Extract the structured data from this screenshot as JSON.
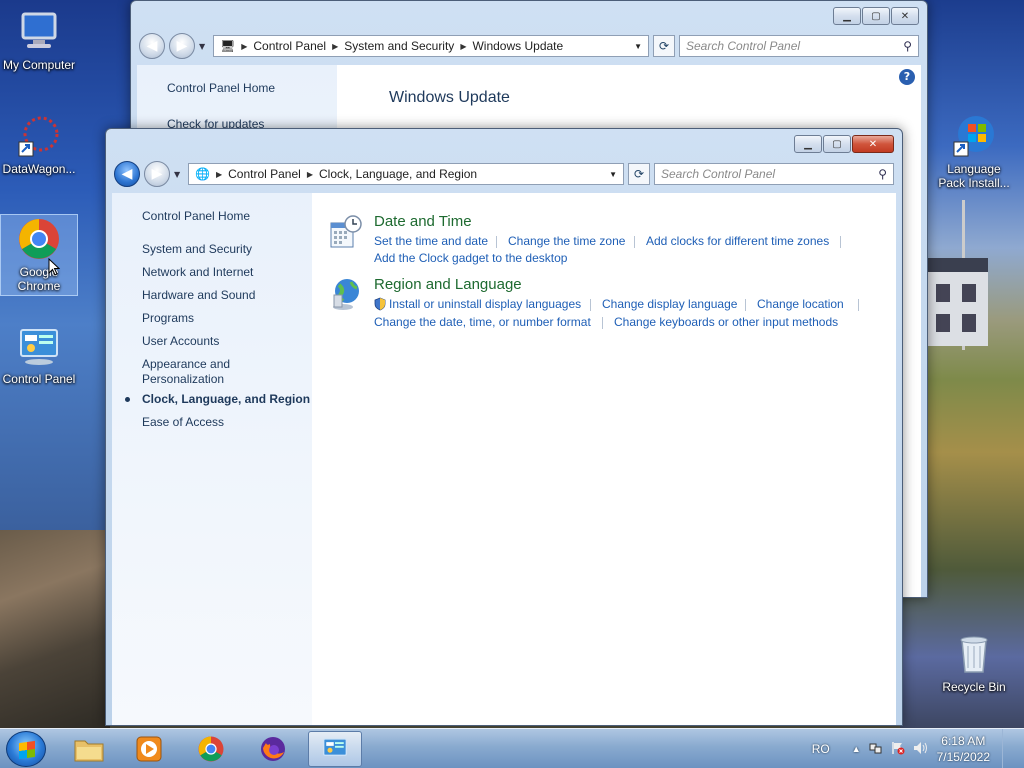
{
  "desktop": {
    "icons": [
      {
        "label": "My Computer"
      },
      {
        "label": "DataWagon..."
      },
      {
        "label": "Google Chrome"
      },
      {
        "label": "Control Panel"
      },
      {
        "label": "Language Pack Install..."
      },
      {
        "label": "Recycle Bin"
      }
    ]
  },
  "back_window": {
    "breadcrumb": [
      "Control Panel",
      "System and Security",
      "Windows Update"
    ],
    "search_placeholder": "Search Control Panel",
    "sidebar": [
      "Control Panel Home",
      "Check for updates"
    ],
    "title": "Windows Update",
    "help": "?"
  },
  "front_window": {
    "breadcrumb": [
      "Control Panel",
      "Clock, Language, and Region"
    ],
    "search_placeholder": "Search Control Panel",
    "sidebar": {
      "home": "Control Panel Home",
      "items": [
        "System and Security",
        "Network and Internet",
        "Hardware and Sound",
        "Programs",
        "User Accounts",
        "Appearance and Personalization",
        "Clock, Language, and Region",
        "Ease of Access"
      ],
      "current_index": 6
    },
    "categories": [
      {
        "title": "Date and Time",
        "links": [
          "Set the time and date",
          "Change the time zone",
          "Add clocks for different time zones",
          "Add the Clock gadget to the desktop"
        ]
      },
      {
        "title": "Region and Language",
        "links": [
          "Install or uninstall display languages",
          "Change display language",
          "Change location",
          "Change the date, time, or number format",
          "Change keyboards or other input methods"
        ]
      }
    ]
  },
  "taskbar": {
    "language": "RO",
    "time": "6:18 AM",
    "date": "7/15/2022"
  },
  "colors": {
    "link": "#1f5fb6",
    "category_title": "#1e6a30",
    "sidebar_text": "#1e395b"
  }
}
